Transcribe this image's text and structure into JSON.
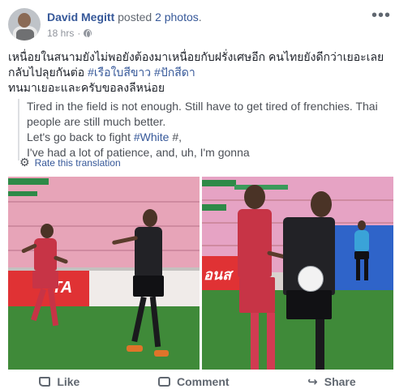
{
  "post": {
    "author": "David Megitt",
    "posted_text": " posted ",
    "photo_count_text": "2 photos",
    "period": ".",
    "timestamp": "18 hrs",
    "separator": "·",
    "more_icon": "more-horizontal-icon",
    "thai_line1": "เหนื่อยในสนามยังไม่พอยังต้องมาเหนื่อยกับฝรั่งเศษอีก คนไทยยังดีกว่าเยอะเลย",
    "thai_line2_a": "กลับไปลุยกันต่อ ",
    "hashtag1": "#เรือใบสีขาว",
    "hashtag2": "#ปักสีดา",
    "thai_line3": "ทนมาเยอะและครับขอลงลีหน่อย",
    "translation_line1": "Tired in the field is not enough. Still have to get tired of frenchies. Thai people are still much better.",
    "translation_line2_a": "Let's go back to fight ",
    "translation_hashtag": "#White",
    "translation_line2_b": " #,",
    "translation_line3": "I've had a lot of patience, and, uh, I'm gonna",
    "rate_translation": "Rate this translation"
  },
  "photos": {
    "photo1_ad_text": "TA",
    "photo2_ad_text": "อนส"
  },
  "actions": {
    "like": "Like",
    "comment": "Comment",
    "share": "Share"
  },
  "colors": {
    "link": "#365899",
    "text": "#1d2129",
    "muted": "#90949c"
  }
}
